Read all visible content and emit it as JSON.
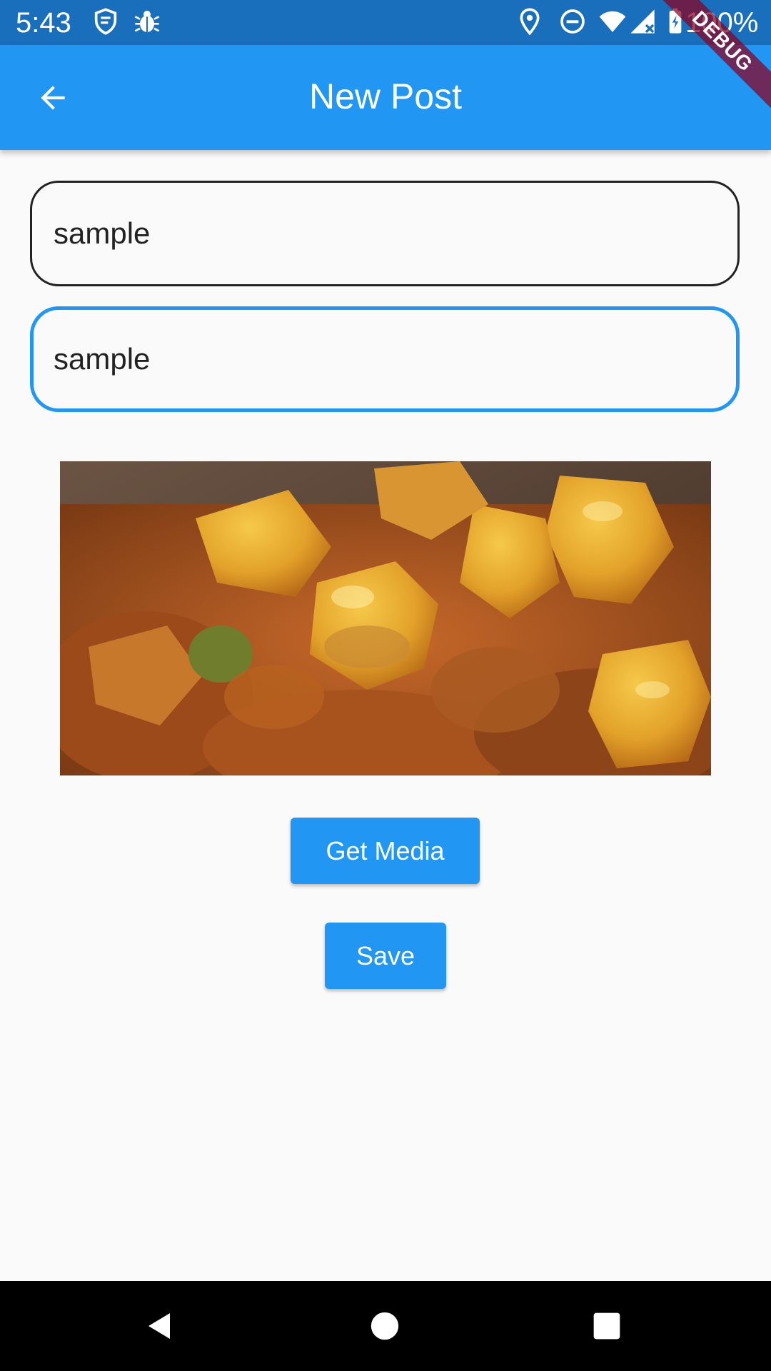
{
  "status_bar": {
    "time": "5:43",
    "battery": "100%",
    "icons": [
      "shield-icon",
      "bug-icon",
      "location-icon",
      "do-not-disturb-icon",
      "wifi-icon",
      "signal-icon",
      "battery-icon"
    ],
    "background_color": "#1a6fbd"
  },
  "app_bar": {
    "title": "New Post",
    "back_icon": "arrow-back-icon",
    "background_color": "#2196f3"
  },
  "debug_banner": {
    "label": "DEBUG"
  },
  "form": {
    "title_value": "sample",
    "body_value": "sample",
    "focused_field": "body",
    "focus_color": "#2196f3"
  },
  "media": {
    "preview_description_icon": "food-photo"
  },
  "actions": {
    "get_media_label": "Get Media",
    "save_label": "Save",
    "button_color": "#2196f3"
  },
  "nav_bar": {
    "icons": [
      "back-triangle-icon",
      "home-circle-icon",
      "recents-square-icon"
    ]
  }
}
